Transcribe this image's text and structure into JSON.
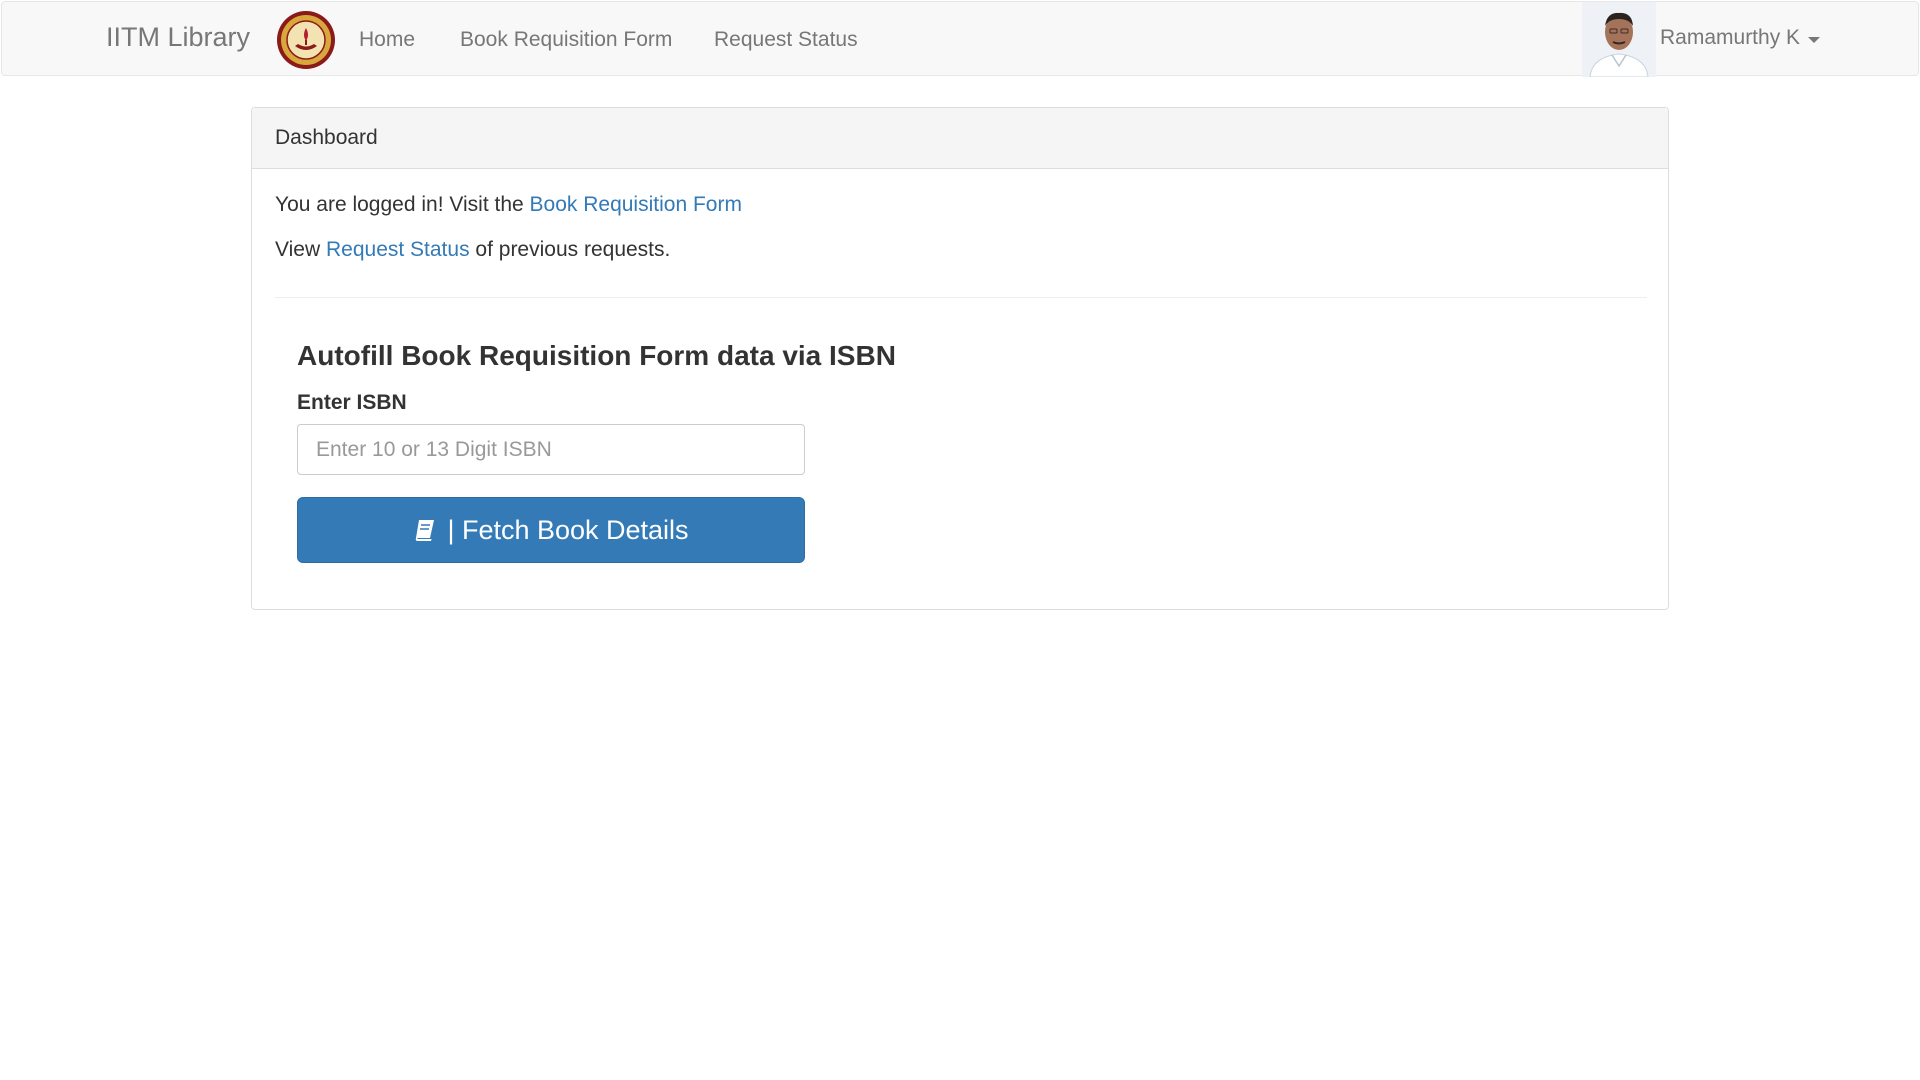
{
  "navbar": {
    "brand": "IITM Library",
    "logo_icon": "iitm-seal-logo",
    "links": [
      {
        "label": "Home"
      },
      {
        "label": "Book Requisition Form"
      },
      {
        "label": "Request Status"
      }
    ],
    "user": {
      "name": "Ramamurthy K",
      "avatar_icon": "user-avatar-photo"
    }
  },
  "panel": {
    "heading": "Dashboard",
    "line1_prefix": "You are logged in! Visit the ",
    "line1_link": "Book Requisition Form",
    "line2_prefix": "View ",
    "line2_link": "Request Status",
    "line2_suffix": " of previous requests."
  },
  "autofill": {
    "title": "Autofill Book Requisition Form data via ISBN",
    "label": "Enter ISBN",
    "placeholder": "Enter 10 or 13 Digit ISBN",
    "value": "",
    "button_label": " | Fetch Book Details",
    "button_icon": "book-icon"
  },
  "colors": {
    "navbar_bg": "#f8f8f8",
    "link": "#337ab7",
    "primary_button": "#337ab7",
    "panel_heading_bg": "#f5f5f5"
  }
}
